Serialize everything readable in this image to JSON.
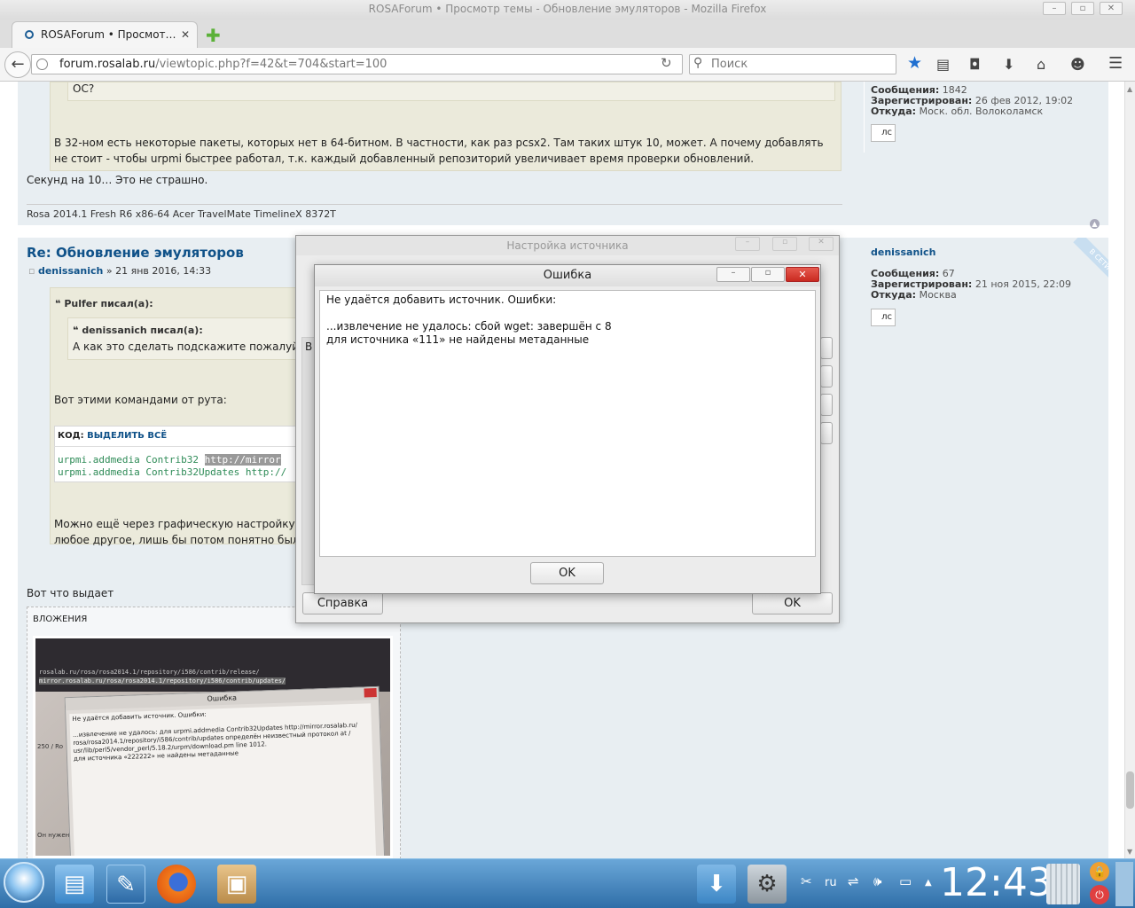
{
  "window": {
    "title": "ROSAForum • Просмотр темы - Обновление эмуляторов - Mozilla Firefox"
  },
  "tab": {
    "label": "ROSAForum • Просмот…"
  },
  "nav": {
    "url_host": "forum.rosalab.ru",
    "url_path": "/viewtopic.php?f=42&t=704&start=100",
    "search_placeholder": "Поиск"
  },
  "post1": {
    "quote_tail": "ОС?",
    "quote_text": "В 32-ном есть некоторые пакеты, которых нет в 64-битном. В частности, как раз pcsx2. Там таких штук 10, может. А почему добавлять не стоит - чтобы urpmi быстрее работал, т.к. каждый добавленный репозиторий увеличивает время проверки обновлений.",
    "body": "Секунд на 10… Это не страшно.",
    "signature": "Rosa 2014.1 Fresh R6 x86-64 Acer TravelMate TimelineX 8372T",
    "profile": {
      "posts_label": "Сообщения:",
      "posts": "1842",
      "reg_label": "Зарегистрирован:",
      "reg": "26 фев 2012, 19:02",
      "from_label": "Откуда:",
      "from": "Моск. обл. Волоколамск",
      "pm": "лс"
    }
  },
  "post2": {
    "title": "Re: Обновление эмуляторов",
    "author": "denissanich",
    "date": " » 21 янв 2016, 14:33",
    "quote_author": "Pulfer писал(а):",
    "inner_quote_author": "denissanich писал(а):",
    "inner_quote_text": "А как это сделать подскажите пожалуйста",
    "text1": "Вот этими командами от рута:",
    "code_label": "КОД:",
    "code_select": "ВЫДЕЛИТЬ ВСЁ",
    "code_line1": "urpmi.addmedia Contrib32 ",
    "code_line1_sel": "http://mirror",
    "code_line2": "urpmi.addmedia Contrib32Updates http://",
    "text2a": "Можно ещё через графическую настройку репоз",
    "text2b": "любое другое, лишь бы потом понятно было). UI",
    "body": "Вот что выдает",
    "attachments_label": "ВЛОЖЕНИЯ",
    "badge": "В СЕТИ",
    "profile": {
      "name": "denissanich",
      "posts_label": "Сообщения:",
      "posts": "67",
      "reg_label": "Зарегистрирован:",
      "reg": "21 ноя 2015, 22:09",
      "from_label": "Откуда:",
      "from": "Москва",
      "pm": "лс"
    }
  },
  "photo": {
    "line1": "rosalab.ru/rosa/rosa2014.1/repository/i586/contrib/release/",
    "line2": "mirror.rosalab.ru/rosa/rosa2014.1/repository/i586/contrib/updates/",
    "dlg_title": "Ошибка",
    "dlg_head": "Не удаётся добавить источник. Ошибки:",
    "dlg_body1": "...извлечение не удалось: для urpmi.addmedia Contrib32Updates http://mirror.rosalab.ru/",
    "dlg_body2": "rosa/rosa2014.1/repository/i586/contrib/updates определён неизвестный протокол at /",
    "dlg_body3": "usr/lib/perl5/vendor_perl/5.18.2/urpm/download.pm line 1012.",
    "dlg_body4": "для источника «222222» не найдены метаданные",
    "side": "250 / Ro",
    "bottom": "Он нужен в"
  },
  "dialog_source": {
    "title": "Настройка источника",
    "help": "Справка",
    "ok": "OK",
    "partial": "В"
  },
  "dialog_error": {
    "title": "Ошибка",
    "line1": "Не удаётся добавить источник. Ошибки:",
    "line2": "...извлечение не удалось: сбой wget: завершён с 8",
    "line3": "для источника «111» не найдены метаданные",
    "ok": "OK"
  },
  "taskbar": {
    "clock": "12:43",
    "lang": "ru"
  }
}
